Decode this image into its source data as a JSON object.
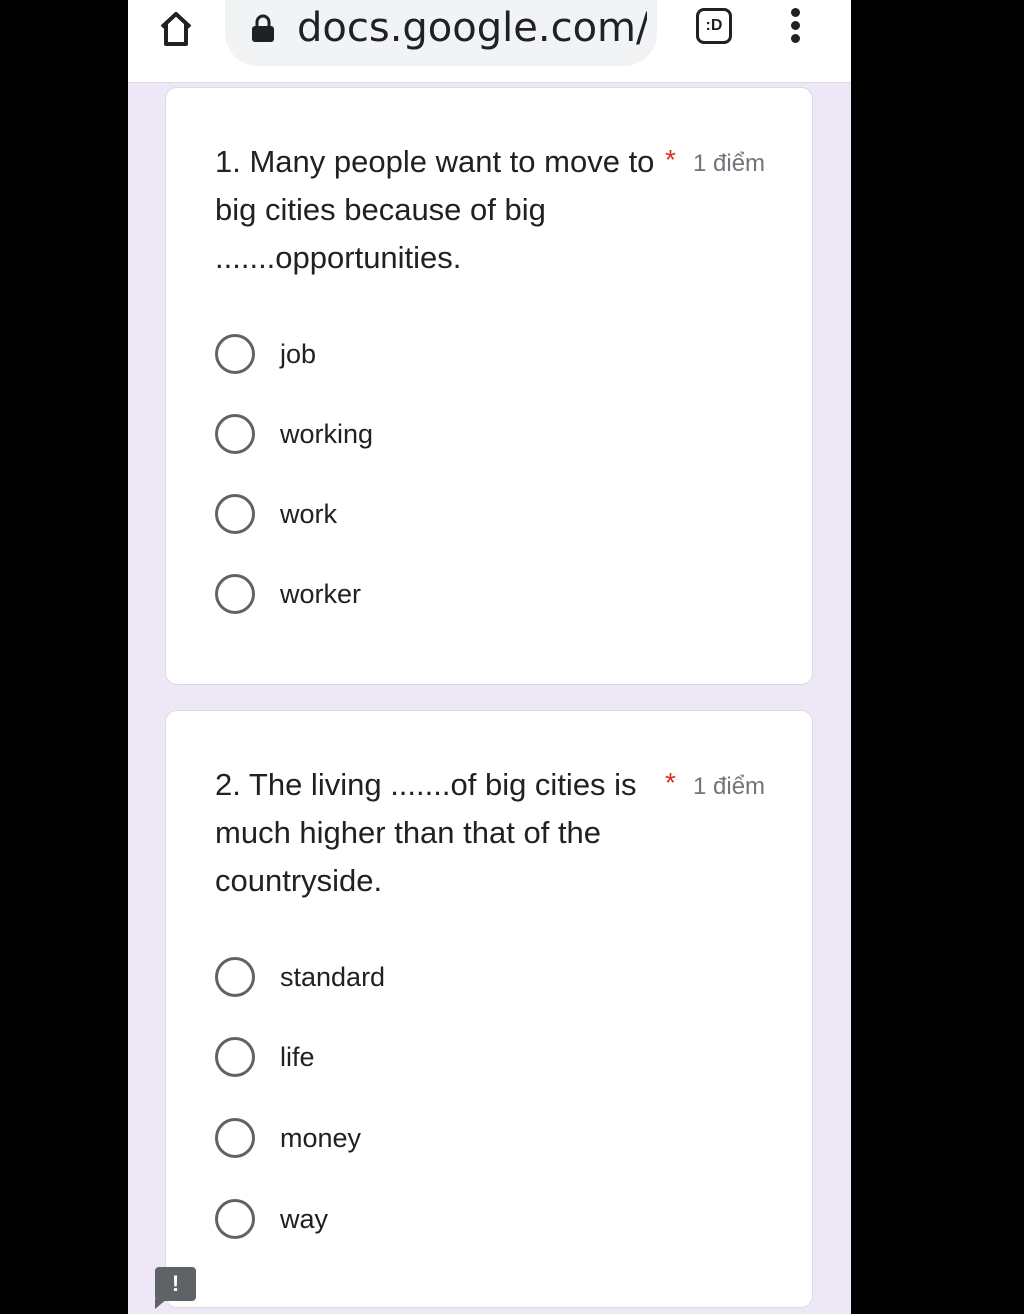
{
  "browser": {
    "url": "docs.google.com/",
    "tab_switcher_label": ":D"
  },
  "questions": [
    {
      "title": "1. Many people want to move to big cities because of big .......opportunities.",
      "required_marker": "*",
      "points": "1 điểm",
      "options": [
        "job",
        "working",
        "work",
        "worker"
      ]
    },
    {
      "title": "2. The living .......of big cities is much higher than that of the countryside.",
      "required_marker": "*",
      "points": "1 điểm",
      "options": [
        "standard",
        "life",
        "money",
        "way"
      ]
    }
  ],
  "feedback_button": {
    "label": "!"
  }
}
